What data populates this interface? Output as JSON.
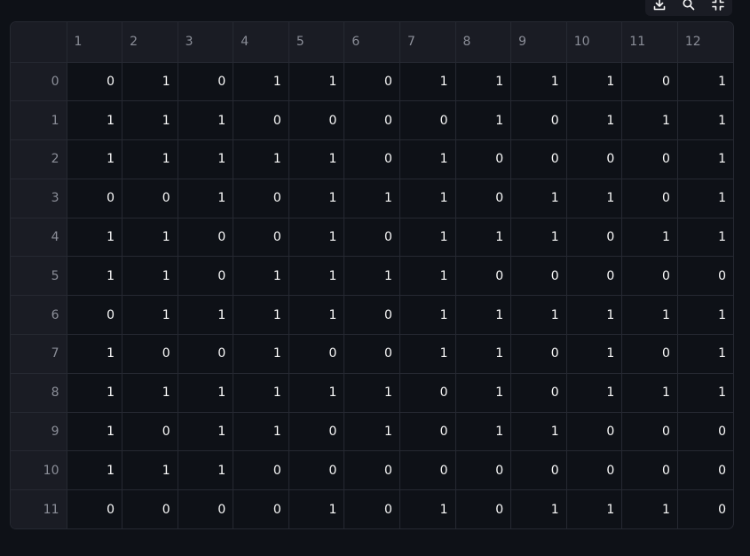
{
  "toolbar": {
    "download_icon": "download-icon",
    "search_icon": "search-icon",
    "fullscreen_icon": "fullscreen-exit-icon"
  },
  "table": {
    "corner": "",
    "columns": [
      "1",
      "2",
      "3",
      "4",
      "5",
      "6",
      "7",
      "8",
      "9",
      "10",
      "11",
      "12"
    ],
    "rows": [
      {
        "index": "0",
        "cells": [
          "0",
          "1",
          "0",
          "1",
          "1",
          "0",
          "1",
          "1",
          "1",
          "1",
          "0",
          "1"
        ]
      },
      {
        "index": "1",
        "cells": [
          "1",
          "1",
          "1",
          "0",
          "0",
          "0",
          "0",
          "1",
          "0",
          "1",
          "1",
          "1"
        ]
      },
      {
        "index": "2",
        "cells": [
          "1",
          "1",
          "1",
          "1",
          "1",
          "0",
          "1",
          "0",
          "0",
          "0",
          "0",
          "1"
        ]
      },
      {
        "index": "3",
        "cells": [
          "0",
          "0",
          "1",
          "0",
          "1",
          "1",
          "1",
          "0",
          "1",
          "1",
          "0",
          "1"
        ]
      },
      {
        "index": "4",
        "cells": [
          "1",
          "1",
          "0",
          "0",
          "1",
          "0",
          "1",
          "1",
          "1",
          "0",
          "1",
          "1"
        ]
      },
      {
        "index": "5",
        "cells": [
          "1",
          "1",
          "0",
          "1",
          "1",
          "1",
          "1",
          "0",
          "0",
          "0",
          "0",
          "0"
        ]
      },
      {
        "index": "6",
        "cells": [
          "0",
          "1",
          "1",
          "1",
          "1",
          "0",
          "1",
          "1",
          "1",
          "1",
          "1",
          "1"
        ]
      },
      {
        "index": "7",
        "cells": [
          "1",
          "0",
          "0",
          "1",
          "0",
          "0",
          "1",
          "1",
          "0",
          "1",
          "0",
          "1"
        ]
      },
      {
        "index": "8",
        "cells": [
          "1",
          "1",
          "1",
          "1",
          "1",
          "1",
          "0",
          "1",
          "0",
          "1",
          "1",
          "1"
        ]
      },
      {
        "index": "9",
        "cells": [
          "1",
          "0",
          "1",
          "1",
          "0",
          "1",
          "0",
          "1",
          "1",
          "0",
          "0",
          "0"
        ]
      },
      {
        "index": "10",
        "cells": [
          "1",
          "1",
          "1",
          "0",
          "0",
          "0",
          "0",
          "0",
          "0",
          "0",
          "0",
          "0"
        ]
      },
      {
        "index": "11",
        "cells": [
          "0",
          "0",
          "0",
          "0",
          "1",
          "0",
          "1",
          "0",
          "1",
          "1",
          "1",
          "0"
        ]
      }
    ]
  }
}
